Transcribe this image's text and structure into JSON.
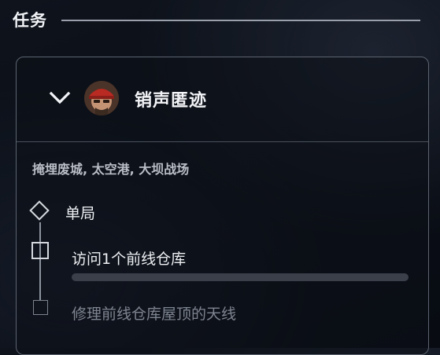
{
  "section": {
    "title": "任务"
  },
  "task": {
    "name": "销声匿迹",
    "expanded": true,
    "locations": "掩埋废城, 太空港, 大坝战场",
    "mode": "单局",
    "objectives": [
      {
        "label": "访问1个前线仓库",
        "progress": 0.0,
        "active": true
      },
      {
        "label": "修理前线仓库屋顶的天线",
        "active": false
      }
    ]
  },
  "icons": {
    "expand": "chevron-down-icon",
    "avatar": "operator-portrait-icon",
    "mode_node": "diamond-node-icon",
    "objective_node": "square-checkbox-icon"
  },
  "colors": {
    "text_primary": "#eef0f3",
    "text_secondary": "#b9bec7",
    "text_disabled": "#7f8591",
    "border": "#5d6470",
    "progress_track": "#3a3f4a"
  }
}
